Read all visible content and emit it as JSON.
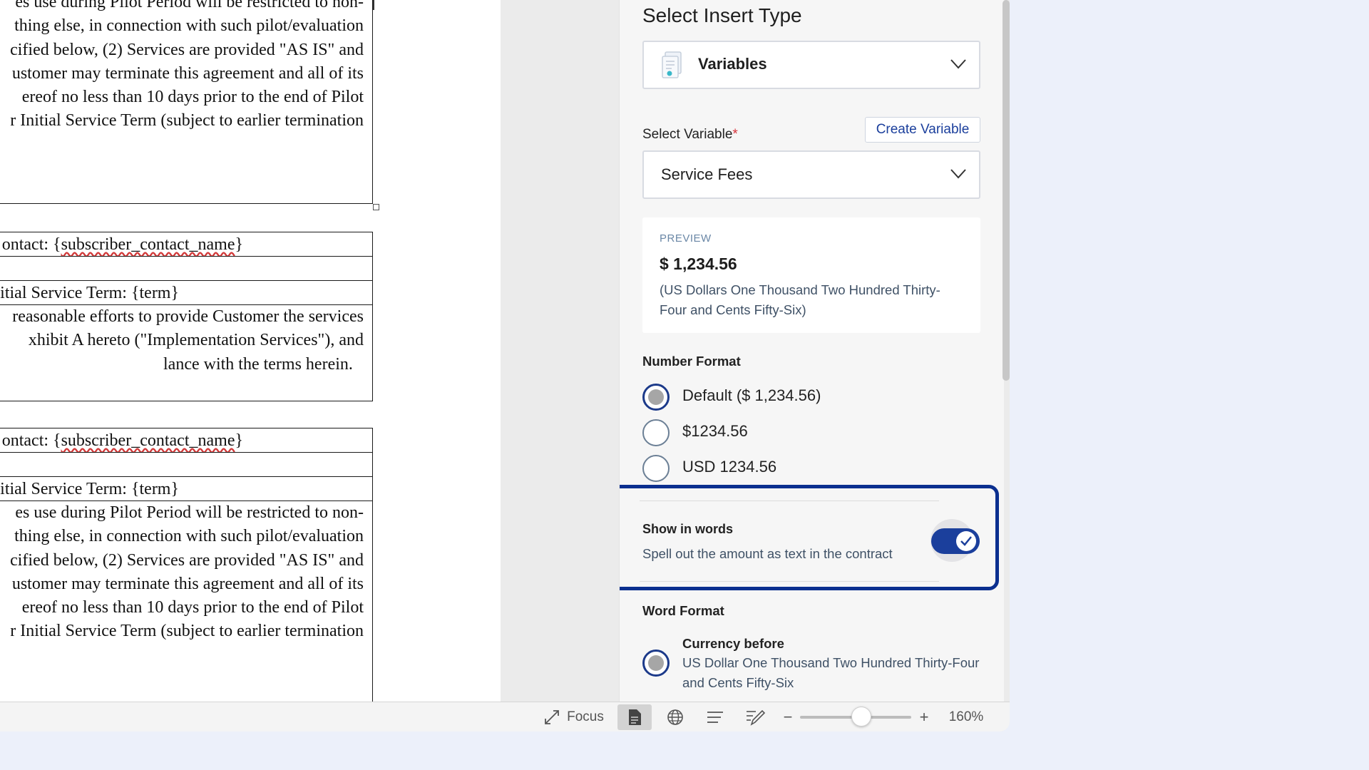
{
  "document": {
    "block1_lines": [
      "es use during Pilot Period will be restricted to non-",
      "thing else, in connection with such pilot/evaluation",
      "cified below, (2) Services are provided \"AS IS\" and",
      "ustomer may terminate this agreement and all of its",
      "ereof no less than 10 days prior to the end of Pilot",
      "r Initial Service Term (subject to earlier termination"
    ],
    "contact_prefix": "ontact: {",
    "contact_placeholder": "subscriber_contact_name",
    "contact_suffix": "}",
    "term_line": "itial Service Term: {term}",
    "block2_lines": [
      "reasonable efforts to provide Customer the services",
      "xhibit A hereto (\"Implementation Services\"), and",
      "lance with the terms herein."
    ],
    "block3_lines": [
      "es use during Pilot Period will be restricted to non-",
      "thing else, in connection with such pilot/evaluation",
      "cified below, (2) Services are provided \"AS IS\" and",
      "ustomer may terminate this agreement and all of its",
      "ereof no less than 10 days prior to the end of Pilot",
      "r Initial Service Term (subject to earlier termination"
    ]
  },
  "panel": {
    "title": "Select Insert Type",
    "insert_type": {
      "value": "Variables",
      "icon": "variables-icon"
    },
    "select_variable_label": "Select Variable",
    "required_mark": "*",
    "create_variable_label": "Create Variable",
    "variable_value": "Service Fees",
    "preview": {
      "label": "PREVIEW",
      "amount": "$ 1,234.56",
      "words": "(US Dollars One Thousand Two Hundred Thirty-Four and Cents Fifty-Six)"
    },
    "number_format": {
      "label": "Number Format",
      "options": [
        "Default ($ 1,234.56)",
        "$1234.56",
        "USD 1234.56"
      ],
      "selected": 0
    },
    "show_in_words": {
      "title": "Show in words",
      "description": "Spell out the amount as text in the contract",
      "enabled": true
    },
    "word_format": {
      "label": "Word Format",
      "option_title": "Currency before",
      "option_desc": "US Dollar One Thousand Two Hundred Thirty-Four and Cents Fifty-Six"
    }
  },
  "statusbar": {
    "focus_label": "Focus",
    "zoom_minus": "−",
    "zoom_plus": "+",
    "zoom_level": "160%",
    "zoom_fraction": 0.55
  },
  "colors": {
    "accent": "#1b3f9c",
    "highlight_border": "#0b2f8f",
    "required": "#d6323a"
  }
}
